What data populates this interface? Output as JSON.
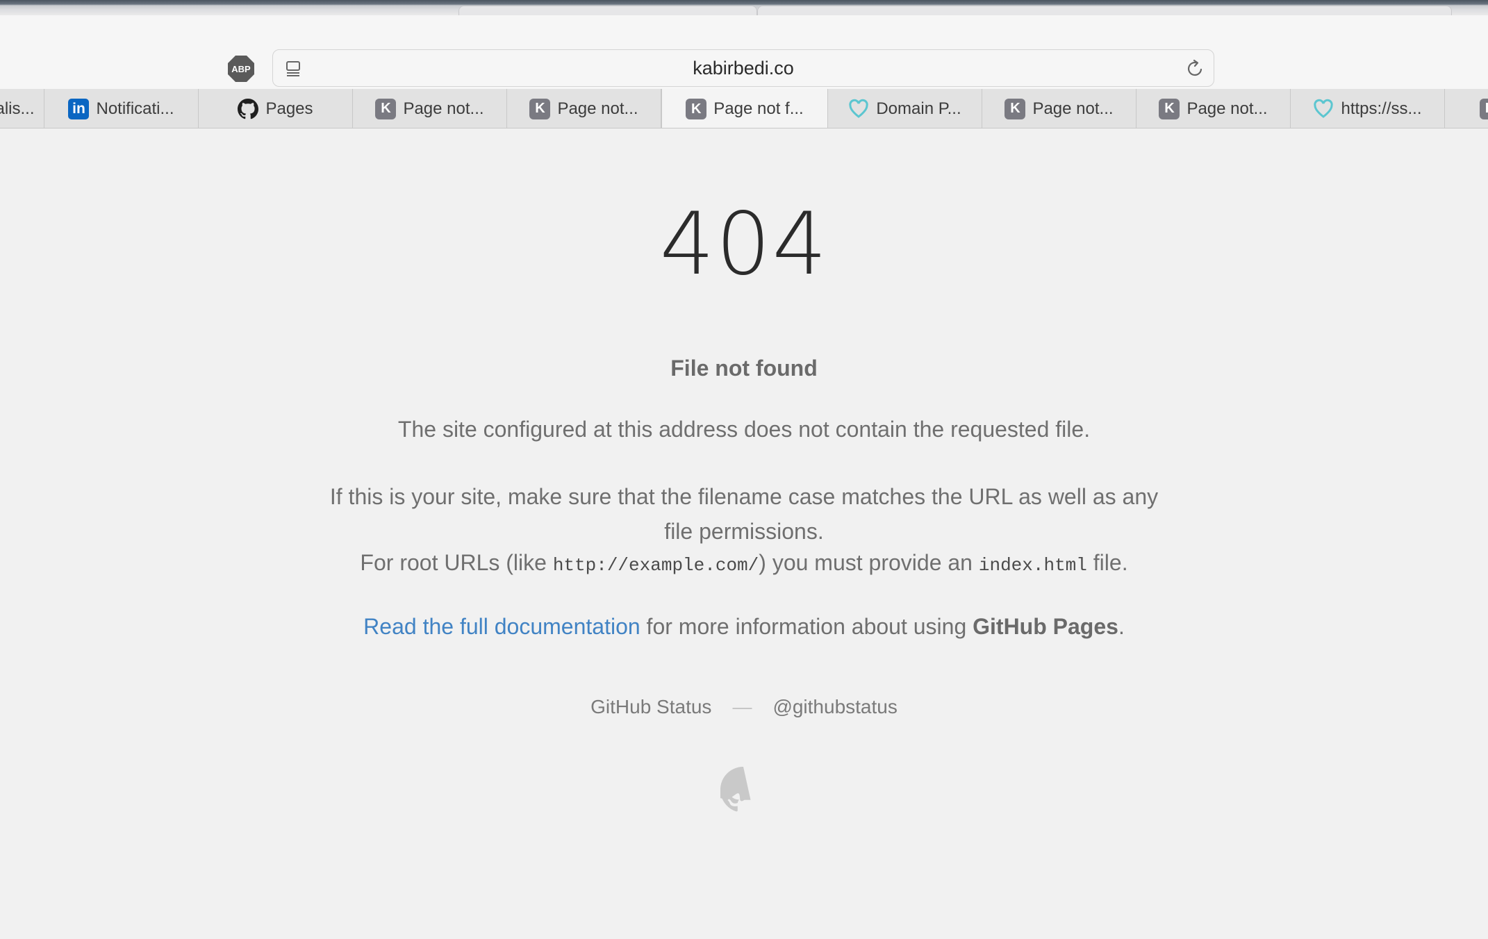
{
  "browser": {
    "address_url": "kabirbedi.co",
    "adblock_label": "ABP",
    "tabs": [
      {
        "title": "alis...",
        "icon": "none",
        "active": false
      },
      {
        "title": "Notificati...",
        "icon": "linkedin-icon",
        "active": false
      },
      {
        "title": "Pages",
        "icon": "github-icon",
        "active": false
      },
      {
        "title": "Page not...",
        "icon": "k-icon",
        "active": false
      },
      {
        "title": "Page not...",
        "icon": "k-icon",
        "active": false
      },
      {
        "title": "Page not f...",
        "icon": "k-icon",
        "active": true
      },
      {
        "title": "Domain P...",
        "icon": "heart-outline-icon",
        "active": false
      },
      {
        "title": "Page not...",
        "icon": "k-icon",
        "active": false
      },
      {
        "title": "Page not...",
        "icon": "k-icon",
        "active": false
      },
      {
        "title": "https://ss...",
        "icon": "heart-outline-icon",
        "active": false
      }
    ],
    "fav_k_letter": "K",
    "fav_in_letter": "in"
  },
  "page": {
    "code": "404",
    "heading": "File not found",
    "p1": "The site configured at this address does not contain the requested file.",
    "p2": "If this is your site, make sure that the filename case matches the URL as well as any file permissions.",
    "p3_before": "For root URLs (like ",
    "p3_code1": "http://example.com/",
    "p3_middle": ") you must provide an ",
    "p3_code2": "index.html",
    "p3_after": " file.",
    "p4_link": "Read the full documentation",
    "p4_middle": " for more information about using ",
    "p4_bold": "GitHub Pages",
    "p4_after": ".",
    "footer_status": "GitHub Status",
    "footer_sep": "—",
    "footer_twitter": "@githubstatus"
  },
  "colors": {
    "link": "#4183c4",
    "linkedin": "#0a66c2",
    "k_favicon": "#7a7a82",
    "heart_favicon": "#5cc6d0"
  }
}
